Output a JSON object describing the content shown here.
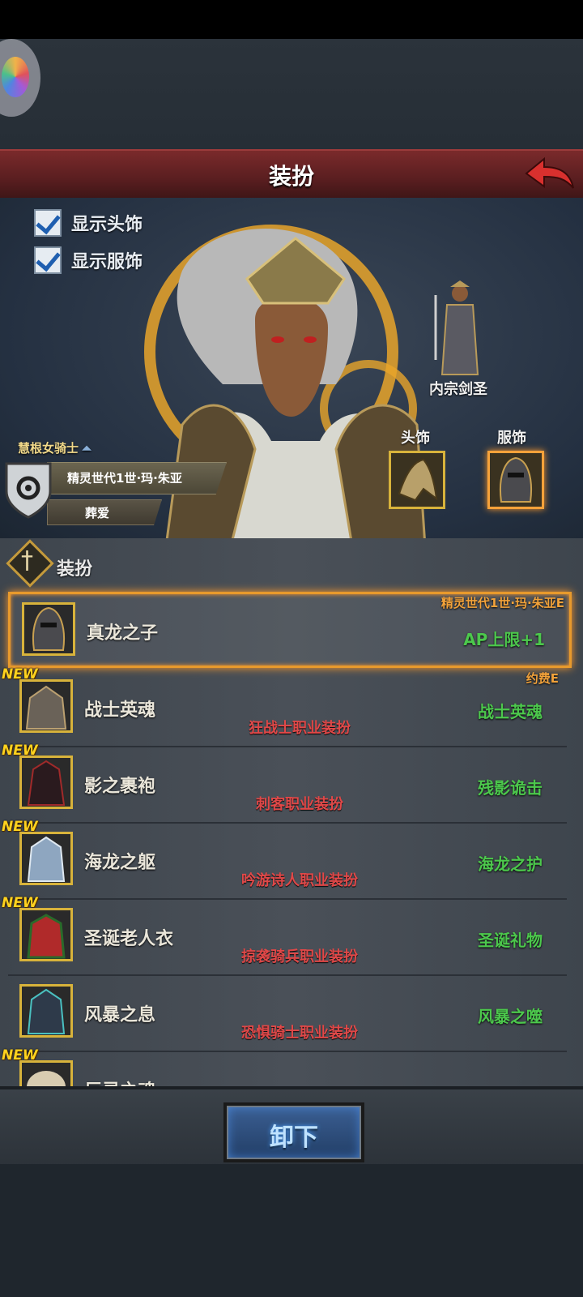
{
  "header": {
    "title": "装扮"
  },
  "preview": {
    "options": [
      {
        "label": "显示头饰",
        "checked": true
      },
      {
        "label": "显示服饰",
        "checked": true
      }
    ],
    "mini_character_name": "内宗剑圣",
    "slot_labels": {
      "head": "头饰",
      "outfit": "服饰"
    },
    "character": {
      "class_name": "慧根女骑士",
      "full_name": "精灵世代1世·玛·朱亚",
      "title": "葬爱"
    }
  },
  "list": {
    "header_label": "装扮",
    "new_badge": "NEW",
    "selected": {
      "name": "真龙之子",
      "owner": "精灵世代1世·玛·朱亚E",
      "effect": "AP上限+1",
      "price": "约费E"
    },
    "items": [
      {
        "name": "战士英魂",
        "class_note": "狂战士职业装扮",
        "effect": "战士英魂"
      },
      {
        "name": "影之裹袍",
        "class_note": "刺客职业装扮",
        "effect": "残影诡击"
      },
      {
        "name": "海龙之躯",
        "class_note": "吟游诗人职业装扮",
        "effect": "海龙之护"
      },
      {
        "name": "圣诞老人衣",
        "class_note": "掠袭骑兵职业装扮",
        "effect": "圣诞礼物"
      },
      {
        "name": "风暴之息",
        "class_note": "恐惧骑士职业装扮",
        "effect": "风暴之噬"
      },
      {
        "name": "巨灵之魂",
        "class_note": "",
        "effect": ""
      }
    ]
  },
  "footer": {
    "unequip_label": "卸下"
  },
  "colors": {
    "title_bar": "#6a2526",
    "selection_border": "#e89a2c",
    "effect_text": "#4cc84c",
    "class_note_text": "#e04848",
    "new_badge": "#ffd21e"
  }
}
